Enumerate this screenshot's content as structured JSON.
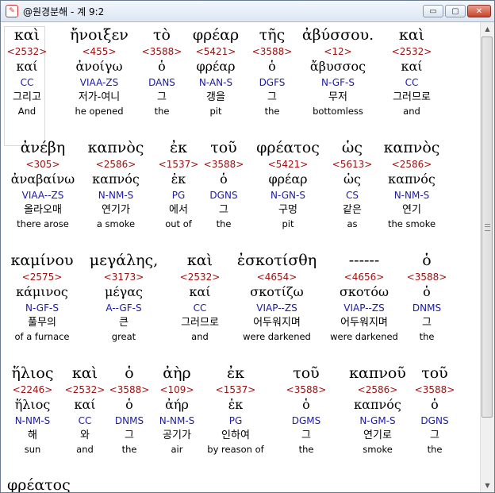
{
  "window": {
    "title": "@원경분해 - 계 9:2",
    "icon": "bible-app-icon",
    "controls": {
      "minimize": "▭",
      "maximize": "▢",
      "close": "✕"
    }
  },
  "rows": [
    [
      {
        "greek": "καὶ",
        "strong": "<2532>",
        "lex": "καί",
        "parse": "CC",
        "korean": "그리고",
        "english": "And"
      },
      {
        "greek": "ἤνοιξεν",
        "strong": "<455>",
        "lex": "ἀνοίγω",
        "parse": "VIAA-ZS",
        "korean": "저가-여니",
        "english": "he opened"
      },
      {
        "greek": "τὸ",
        "strong": "<3588>",
        "lex": "ὁ",
        "parse": "DANS",
        "korean": "그",
        "english": "the"
      },
      {
        "greek": "φρέαρ",
        "strong": "<5421>",
        "lex": "φρέαρ",
        "parse": "N-AN-S",
        "korean": "갱을",
        "english": "pit"
      },
      {
        "greek": "τῆς",
        "strong": "<3588>",
        "lex": "ὁ",
        "parse": "DGFS",
        "korean": "그",
        "english": "the"
      },
      {
        "greek": "ἀβύσσου.",
        "strong": "<12>",
        "lex": "ἄβυσσος",
        "parse": "N-GF-S",
        "korean": "무저",
        "english": "bottomless"
      },
      {
        "greek": "καὶ",
        "strong": "<2532>",
        "lex": "καί",
        "parse": "CC",
        "korean": "그러므로",
        "english": "and"
      }
    ],
    [
      {
        "greek": "ἀνέβη",
        "strong": "<305>",
        "lex": "ἀναβαίνω",
        "parse": "VIAA--ZS",
        "korean": "올라오매",
        "english": "there arose"
      },
      {
        "greek": "καπνὸς",
        "strong": "<2586>",
        "lex": "καπνός",
        "parse": "N-NM-S",
        "korean": "연기가",
        "english": "a smoke"
      },
      {
        "greek": "ἐκ",
        "strong": "<1537>",
        "lex": "ἐκ",
        "parse": "PG",
        "korean": "에서",
        "english": "out of"
      },
      {
        "greek": "τοῦ",
        "strong": "<3588>",
        "lex": "ὁ",
        "parse": "DGNS",
        "korean": "그",
        "english": "the"
      },
      {
        "greek": "φρέατος",
        "strong": "<5421>",
        "lex": "φρέαρ",
        "parse": "N-GN-S",
        "korean": "구멍",
        "english": "pit"
      },
      {
        "greek": "ὡς",
        "strong": "<5613>",
        "lex": "ὡς",
        "parse": "CS",
        "korean": "같은",
        "english": "as"
      },
      {
        "greek": "καπνὸς",
        "strong": "<2586>",
        "lex": "καπνός",
        "parse": "N-NM-S",
        "korean": "연기",
        "english": "the smoke"
      }
    ],
    [
      {
        "greek": "καμίνου",
        "strong": "<2575>",
        "lex": "κάμινος",
        "parse": "N-GF-S",
        "korean": "풀무의",
        "english": "of a furnace"
      },
      {
        "greek": "μεγάλης,",
        "strong": "<3173>",
        "lex": "μέγας",
        "parse": "A--GF-S",
        "korean": "큰",
        "english": "great"
      },
      {
        "greek": "καὶ",
        "strong": "<2532>",
        "lex": "καί",
        "parse": "CC",
        "korean": "그러므로",
        "english": "and"
      },
      {
        "greek": "ἐσκοτίσθη",
        "strong": "<4654>",
        "lex": "σκοτίζω",
        "parse": "VIAP--ZS",
        "korean": "어두워지며",
        "english": "were darkened"
      },
      {
        "greek": "------",
        "strong": "<4656>",
        "lex": "σκοτόω",
        "parse": "VIAP--ZS",
        "korean": "어두워지며",
        "english": "were darkened"
      },
      {
        "greek": "ὁ",
        "strong": "<3588>",
        "lex": "ὁ",
        "parse": "DNMS",
        "korean": "그",
        "english": "the"
      }
    ],
    [
      {
        "greek": "ἥλιος",
        "strong": "<2246>",
        "lex": "ἥλιος",
        "parse": "N-NM-S",
        "korean": "해",
        "english": "sun"
      },
      {
        "greek": "καὶ",
        "strong": "<2532>",
        "lex": "καί",
        "parse": "CC",
        "korean": "와",
        "english": "and"
      },
      {
        "greek": "ὁ",
        "strong": "<3588>",
        "lex": "ὁ",
        "parse": "DNMS",
        "korean": "그",
        "english": "the"
      },
      {
        "greek": "ἀὴρ",
        "strong": "<109>",
        "lex": "ἀήρ",
        "parse": "N-NM-S",
        "korean": "공기가",
        "english": "air"
      },
      {
        "greek": "ἐκ",
        "strong": "<1537>",
        "lex": "ἐκ",
        "parse": "PG",
        "korean": "인하여",
        "english": "by reason of"
      },
      {
        "greek": "τοῦ",
        "strong": "<3588>",
        "lex": "ὁ",
        "parse": "DGMS",
        "korean": "그",
        "english": "the"
      },
      {
        "greek": "καπνοῦ",
        "strong": "<2586>",
        "lex": "καπνός",
        "parse": "N-GM-S",
        "korean": "연기로",
        "english": "smoke"
      },
      {
        "greek": "τοῦ",
        "strong": "<3588>",
        "lex": "ὁ",
        "parse": "DGNS",
        "korean": "그",
        "english": "the"
      }
    ]
  ],
  "partial_next_word": "φρέατος"
}
